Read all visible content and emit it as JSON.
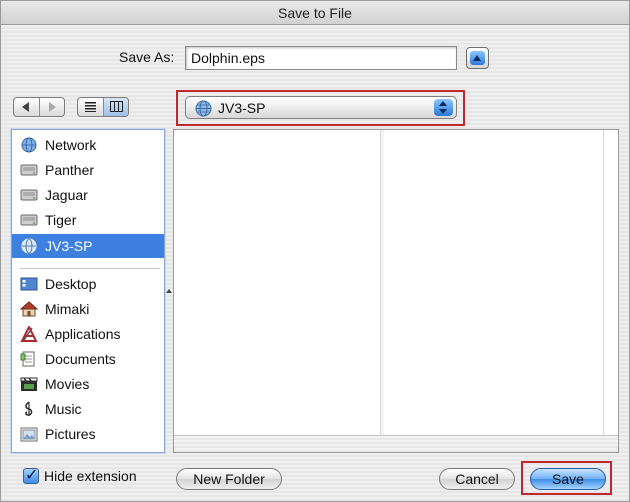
{
  "window": {
    "title": "Save to File"
  },
  "save_as": {
    "label": "Save As:",
    "value": "Dolphin.eps"
  },
  "location": {
    "selected": "JV3-SP"
  },
  "sidebar": {
    "devices": [
      {
        "label": "Network",
        "icon": "network-globe-icon"
      },
      {
        "label": "Panther",
        "icon": "hard-drive-icon"
      },
      {
        "label": "Jaguar",
        "icon": "hard-drive-icon"
      },
      {
        "label": "Tiger",
        "icon": "hard-drive-icon"
      },
      {
        "label": "JV3-SP",
        "icon": "network-volume-icon",
        "selected": true
      }
    ],
    "places": [
      {
        "label": "Desktop",
        "icon": "desktop-icon"
      },
      {
        "label": "Mimaki",
        "icon": "home-icon"
      },
      {
        "label": "Applications",
        "icon": "applications-icon"
      },
      {
        "label": "Documents",
        "icon": "documents-icon"
      },
      {
        "label": "Movies",
        "icon": "movies-icon"
      },
      {
        "label": "Music",
        "icon": "music-icon"
      },
      {
        "label": "Pictures",
        "icon": "pictures-icon"
      }
    ]
  },
  "footer": {
    "hide_extension_label": "Hide extension",
    "hide_extension_checked": true,
    "new_folder_label": "New Folder",
    "cancel_label": "Cancel",
    "save_label": "Save"
  },
  "colors": {
    "selection": "#3d80df",
    "highlight_outline": "#c0282d",
    "default_button": "#3c8de8"
  }
}
